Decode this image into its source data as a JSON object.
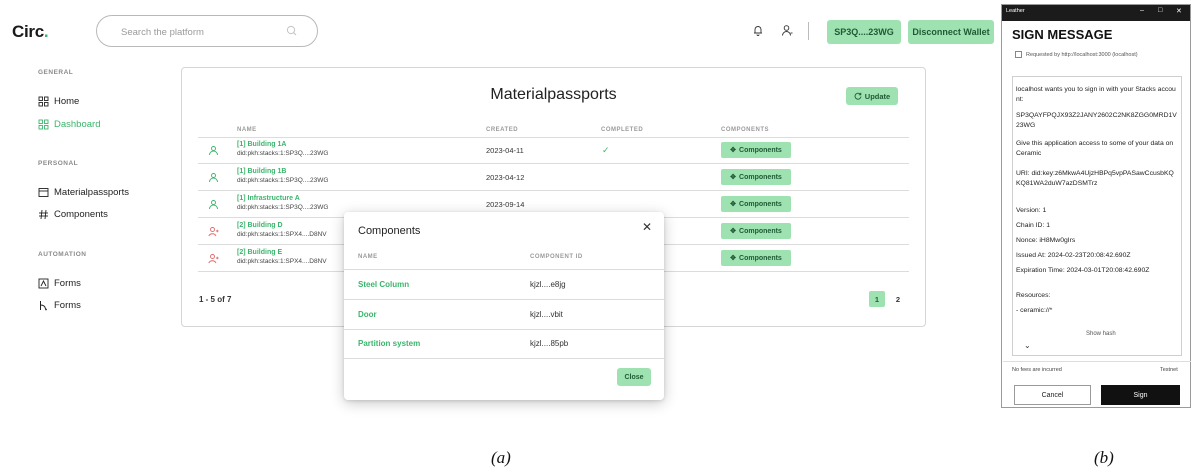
{
  "app": {
    "logo": "Circ",
    "logo_dot": ".",
    "search_placeholder": "Search the platform",
    "wallet_address": "SP3Q....23WG",
    "disconnect_label": "Disconnect Wallet",
    "icons": [
      "search-icon",
      "bell-icon",
      "user-icon"
    ]
  },
  "sidebar": {
    "sections": [
      {
        "heading": "GENERAL",
        "items": [
          {
            "label": "Home",
            "icon": "grid-icon",
            "active": false
          },
          {
            "label": "Dashboard",
            "icon": "grid-icon",
            "active": true
          }
        ]
      },
      {
        "heading": "PERSONAL",
        "items": [
          {
            "label": "Materialpassports",
            "icon": "window-icon",
            "active": false
          },
          {
            "label": "Components",
            "icon": "hash-icon",
            "active": false
          }
        ]
      },
      {
        "heading": "AUTOMATION",
        "items": [
          {
            "label": "Forms",
            "icon": "form-icon",
            "active": false
          },
          {
            "label": "Forms",
            "icon": "branch-icon",
            "active": false
          }
        ]
      }
    ]
  },
  "main": {
    "title": "Materialpassports",
    "update_label": "Update",
    "columns": [
      "NAME",
      "CREATED",
      "COMPLETED",
      "COMPONENTS"
    ],
    "rows": [
      {
        "name": "[1] Building 1A",
        "did": "did:pkh:stacks:1:SP3Q....23WG",
        "created": "2023-04-11",
        "completed": "✓",
        "button": "Components",
        "icon": "user-icon"
      },
      {
        "name": "[1] Building 1B",
        "did": "did:pkh:stacks:1:SP3Q....23WG",
        "created": "2023-04-12",
        "completed": "",
        "button": "Components",
        "icon": "user-icon"
      },
      {
        "name": "[1] Infrastructure A",
        "did": "did:pkh:stacks:1:SP3Q....23WG",
        "created": "2023-09-14",
        "completed": "",
        "button": "Components",
        "icon": "user-icon"
      },
      {
        "name": "[2] Building D",
        "did": "did:pkh:stacks:1:SPX4....D8NV",
        "created": "",
        "completed": "",
        "button": "Components",
        "icon": "user-add-icon"
      },
      {
        "name": "[2] Building E",
        "did": "did:pkh:stacks:1:SPX4....D8NV",
        "created": "",
        "completed": "",
        "button": "Components",
        "icon": "user-add-icon"
      }
    ],
    "pagination": {
      "summary": "1 - 5 of 7",
      "pages": [
        "1",
        "2"
      ],
      "current": "1"
    }
  },
  "modal": {
    "title": "Components",
    "close_symbol": "✕",
    "columns": [
      "NAME",
      "COMPONENT ID"
    ],
    "rows": [
      {
        "name": "Steel Column",
        "id": "kjzl....e8jg"
      },
      {
        "name": "Door",
        "id": "kjzl....vbit"
      },
      {
        "name": "Partition system",
        "id": "kjzl....85pb"
      }
    ],
    "close_label": "Close"
  },
  "captions": {
    "a": "(a)",
    "b": "(b)"
  },
  "wallet": {
    "window_title": "Leather",
    "heading": "SIGN MESSAGE",
    "requested_by": "Requested by http://localhost:3000 (localhost)",
    "lines": [
      "localhost wants you to sign in with your Stacks account:",
      "SP3QAYFPQJX93Z2JANY2602C2NK8ZGG0MRD1V23WG",
      "Give this application access to some of your data on Ceramic",
      "URI: did:key:z6MkwA4UjzHBPq5vpPASawCcusbKQKQ81WA2duW7azDSMTrz",
      "Version: 1",
      "Chain ID: 1",
      "Nonce: iH8Mw0gIrs",
      "Issued At: 2024-02-23T20:08:42.690Z",
      "Expiration Time: 2024-03-01T20:08:42.690Z",
      "Resources:",
      "- ceramic://*"
    ],
    "show_hash": "Show hash",
    "fees_note": "No fees are incurred",
    "network": "Testnet",
    "cancel_label": "Cancel",
    "sign_label": "Sign"
  }
}
